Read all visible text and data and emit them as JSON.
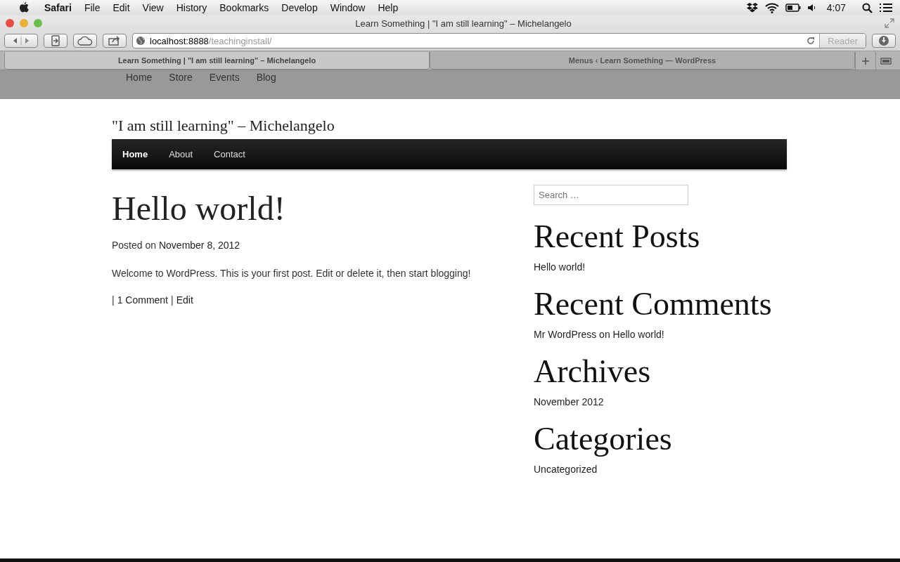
{
  "menubar": {
    "app": "Safari",
    "menus": [
      "File",
      "Edit",
      "View",
      "History",
      "Bookmarks",
      "Develop",
      "Window",
      "Help"
    ],
    "clock": "4:07"
  },
  "browser": {
    "title": "Learn Something | \"I am still learning\" – Michelangelo",
    "url_host": "localhost:8888",
    "url_path": "/teachinginstall/",
    "reader": "Reader",
    "tabs": [
      {
        "label": "Learn Something | \"I am still learning\" – Michelangelo",
        "selected": true
      },
      {
        "label": "Menus ‹ Learn Something — WordPress",
        "selected": false
      }
    ]
  },
  "top_nav": [
    "Home",
    "Store",
    "Events",
    "Blog"
  ],
  "site": {
    "tagline": "\"I am still learning\" – Michelangelo",
    "nav": [
      {
        "label": "Home",
        "selected": true
      },
      {
        "label": "About",
        "selected": false
      },
      {
        "label": "Contact",
        "selected": false
      }
    ]
  },
  "post": {
    "title": "Hello world!",
    "meta_prefix": "Posted on",
    "date": "November 8, 2012",
    "body": "Welcome to WordPress. This is your first post. Edit or delete it, then start blogging!",
    "footer": [
      {
        "kind": "separator",
        "text": "|"
      },
      {
        "kind": "link",
        "text": "1 Comment"
      },
      {
        "kind": "separator",
        "text": "|"
      },
      {
        "kind": "link",
        "text": "Edit"
      }
    ]
  },
  "sidebar": {
    "search_placeholder": "Search …",
    "widgets": [
      {
        "title": "Recent Posts",
        "items": [
          {
            "kind": "link",
            "parts": [
              "Hello world!"
            ]
          }
        ]
      },
      {
        "title": "Recent Comments",
        "items": [
          {
            "kind": "comment",
            "parts": [
              "Mr WordPress",
              "on",
              "Hello world!"
            ]
          }
        ]
      },
      {
        "title": "Archives",
        "items": [
          {
            "kind": "link",
            "parts": [
              "November 2012"
            ]
          }
        ]
      },
      {
        "title": "Categories",
        "items": [
          {
            "kind": "link",
            "parts": [
              "Uncategorized"
            ]
          }
        ]
      }
    ]
  }
}
